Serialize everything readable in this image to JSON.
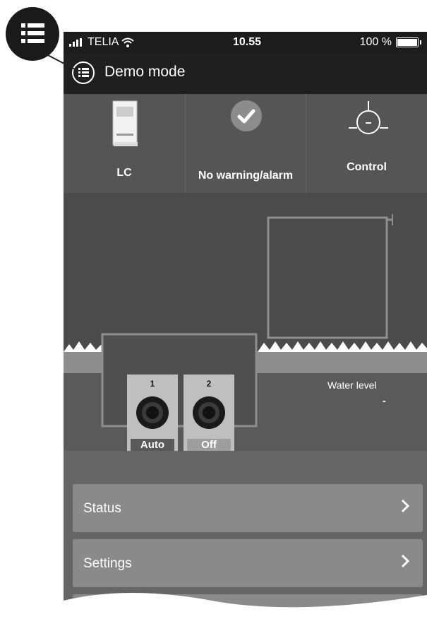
{
  "status_bar": {
    "carrier": "TELIA",
    "time": "10.55",
    "battery": "100 %"
  },
  "nav": {
    "title": "Demo mode",
    "menu_icon": "list-icon"
  },
  "tiles": [
    {
      "label": "LC",
      "icon": "controller-device-icon"
    },
    {
      "label": "No warning/alarm",
      "icon": "checkmark-circle-icon"
    },
    {
      "label": "Control",
      "icon": "control-gauge-icon"
    }
  ],
  "pumps": [
    {
      "number": "1",
      "mode": "Auto"
    },
    {
      "number": "2",
      "mode": "Off"
    }
  ],
  "water_level": {
    "label": "Water level",
    "value": "-"
  },
  "menu": [
    {
      "label": "Status"
    },
    {
      "label": "Settings"
    }
  ],
  "colors": {
    "navbar": "#1f1f1f",
    "tile_bg": "#555555",
    "menu_item": "#8a8a8a",
    "accent": "#ffffff"
  }
}
